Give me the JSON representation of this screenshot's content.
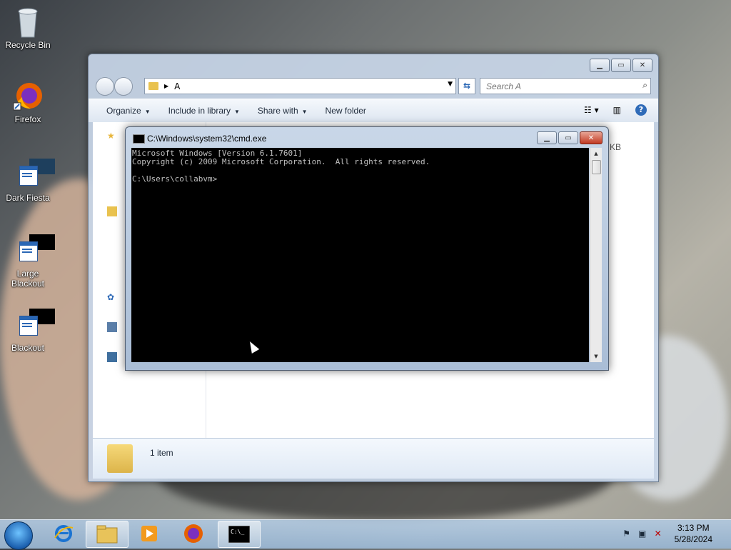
{
  "desktop": {
    "icons": [
      {
        "label": "Recycle Bin",
        "icon": "recycle-bin-icon"
      },
      {
        "label": "Firefox",
        "icon": "firefox-icon"
      },
      {
        "label": "Dark Fiesta",
        "icon": "app-icon"
      },
      {
        "label": "Large Blackout",
        "icon": "app-icon"
      },
      {
        "label": "Blackout",
        "icon": "app-icon"
      }
    ]
  },
  "explorer": {
    "address": "A",
    "search_placeholder": "Search A",
    "toolbar": {
      "organize": "Organize",
      "include_in_library": "Include in library",
      "share_with": "Share with",
      "new_folder": "New folder"
    },
    "size_value": "1 KB",
    "status": "1 item"
  },
  "cmd": {
    "title": "C:\\Windows\\system32\\cmd.exe",
    "lines": [
      "Microsoft Windows [Version 6.1.7601]",
      "Copyright (c) 2009 Microsoft Corporation.  All rights reserved.",
      "",
      "C:\\Users\\collabvm>"
    ]
  },
  "taskbar": {
    "clock_time": "3:13 PM",
    "clock_date": "5/28/2024"
  },
  "colors": {
    "accent": "#2a67b5",
    "console_bg": "#000000",
    "console_fg": "#c0c0c0",
    "close_red": "#c23a22"
  }
}
